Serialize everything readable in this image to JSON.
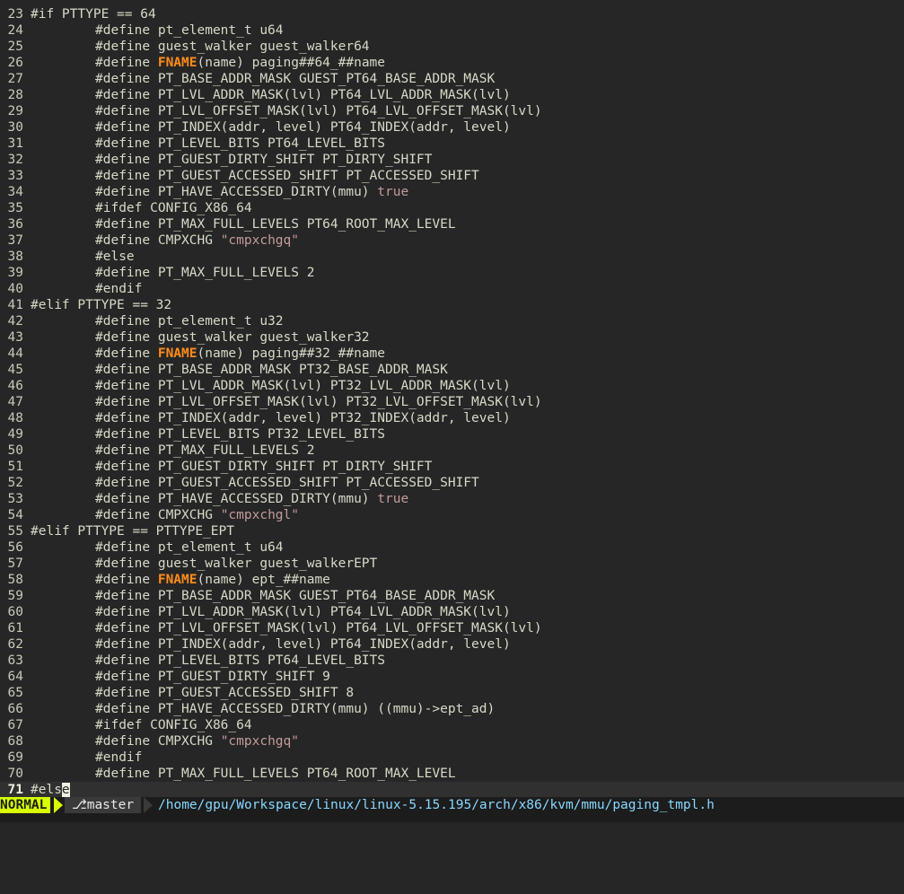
{
  "editor": {
    "current_line": "71",
    "lines": [
      {
        "num": "23",
        "indent": false,
        "tokens": [
          {
            "t": "#if PTTYPE == 64",
            "c": "normal"
          }
        ]
      },
      {
        "num": "24",
        "indent": true,
        "tokens": [
          {
            "t": "#define pt_element_t u64",
            "c": "normal"
          }
        ]
      },
      {
        "num": "25",
        "indent": true,
        "tokens": [
          {
            "t": "#define guest_walker guest_walker64",
            "c": "normal"
          }
        ]
      },
      {
        "num": "26",
        "indent": true,
        "tokens": [
          {
            "t": "#define ",
            "c": "normal"
          },
          {
            "t": "FNAME",
            "c": "fname"
          },
          {
            "t": "(name) paging##64_##name",
            "c": "normal"
          }
        ]
      },
      {
        "num": "27",
        "indent": true,
        "tokens": [
          {
            "t": "#define PT_BASE_ADDR_MASK GUEST_PT64_BASE_ADDR_MASK",
            "c": "normal"
          }
        ]
      },
      {
        "num": "28",
        "indent": true,
        "tokens": [
          {
            "t": "#define PT_LVL_ADDR_MASK(lvl) PT64_LVL_ADDR_MASK(lvl)",
            "c": "normal"
          }
        ]
      },
      {
        "num": "29",
        "indent": true,
        "tokens": [
          {
            "t": "#define PT_LVL_OFFSET_MASK(lvl) PT64_LVL_OFFSET_MASK(lvl)",
            "c": "normal"
          }
        ]
      },
      {
        "num": "30",
        "indent": true,
        "tokens": [
          {
            "t": "#define PT_INDEX(addr, level) PT64_INDEX(addr, level)",
            "c": "normal"
          }
        ]
      },
      {
        "num": "31",
        "indent": true,
        "tokens": [
          {
            "t": "#define PT_LEVEL_BITS PT64_LEVEL_BITS",
            "c": "normal"
          }
        ]
      },
      {
        "num": "32",
        "indent": true,
        "tokens": [
          {
            "t": "#define PT_GUEST_DIRTY_SHIFT PT_DIRTY_SHIFT",
            "c": "normal"
          }
        ]
      },
      {
        "num": "33",
        "indent": true,
        "tokens": [
          {
            "t": "#define PT_GUEST_ACCESSED_SHIFT PT_ACCESSED_SHIFT",
            "c": "normal"
          }
        ]
      },
      {
        "num": "34",
        "indent": true,
        "tokens": [
          {
            "t": "#define PT_HAVE_ACCESSED_DIRTY(mmu) ",
            "c": "normal"
          },
          {
            "t": "true",
            "c": "keyword"
          }
        ]
      },
      {
        "num": "35",
        "indent": true,
        "tokens": [
          {
            "t": "#ifdef CONFIG_X86_64",
            "c": "normal"
          }
        ]
      },
      {
        "num": "36",
        "indent": true,
        "tokens": [
          {
            "t": "#define PT_MAX_FULL_LEVELS PT64_ROOT_MAX_LEVEL",
            "c": "normal"
          }
        ]
      },
      {
        "num": "37",
        "indent": true,
        "tokens": [
          {
            "t": "#define CMPXCHG ",
            "c": "normal"
          },
          {
            "t": "\"cmpxchgq\"",
            "c": "string"
          }
        ]
      },
      {
        "num": "38",
        "indent": true,
        "tokens": [
          {
            "t": "#else",
            "c": "normal"
          }
        ]
      },
      {
        "num": "39",
        "indent": true,
        "tokens": [
          {
            "t": "#define PT_MAX_FULL_LEVELS 2",
            "c": "normal"
          }
        ]
      },
      {
        "num": "40",
        "indent": true,
        "tokens": [
          {
            "t": "#endif",
            "c": "normal"
          }
        ]
      },
      {
        "num": "41",
        "indent": false,
        "tokens": [
          {
            "t": "#elif PTTYPE == 32",
            "c": "normal"
          }
        ]
      },
      {
        "num": "42",
        "indent": true,
        "tokens": [
          {
            "t": "#define pt_element_t u32",
            "c": "normal"
          }
        ]
      },
      {
        "num": "43",
        "indent": true,
        "tokens": [
          {
            "t": "#define guest_walker guest_walker32",
            "c": "normal"
          }
        ]
      },
      {
        "num": "44",
        "indent": true,
        "tokens": [
          {
            "t": "#define ",
            "c": "normal"
          },
          {
            "t": "FNAME",
            "c": "fname"
          },
          {
            "t": "(name) paging##32_##name",
            "c": "normal"
          }
        ]
      },
      {
        "num": "45",
        "indent": true,
        "tokens": [
          {
            "t": "#define PT_BASE_ADDR_MASK PT32_BASE_ADDR_MASK",
            "c": "normal"
          }
        ]
      },
      {
        "num": "46",
        "indent": true,
        "tokens": [
          {
            "t": "#define PT_LVL_ADDR_MASK(lvl) PT32_LVL_ADDR_MASK(lvl)",
            "c": "normal"
          }
        ]
      },
      {
        "num": "47",
        "indent": true,
        "tokens": [
          {
            "t": "#define PT_LVL_OFFSET_MASK(lvl) PT32_LVL_OFFSET_MASK(lvl)",
            "c": "normal"
          }
        ]
      },
      {
        "num": "48",
        "indent": true,
        "tokens": [
          {
            "t": "#define PT_INDEX(addr, level) PT32_INDEX(addr, level)",
            "c": "normal"
          }
        ]
      },
      {
        "num": "49",
        "indent": true,
        "tokens": [
          {
            "t": "#define PT_LEVEL_BITS PT32_LEVEL_BITS",
            "c": "normal"
          }
        ]
      },
      {
        "num": "50",
        "indent": true,
        "tokens": [
          {
            "t": "#define PT_MAX_FULL_LEVELS 2",
            "c": "normal"
          }
        ]
      },
      {
        "num": "51",
        "indent": true,
        "tokens": [
          {
            "t": "#define PT_GUEST_DIRTY_SHIFT PT_DIRTY_SHIFT",
            "c": "normal"
          }
        ]
      },
      {
        "num": "52",
        "indent": true,
        "tokens": [
          {
            "t": "#define PT_GUEST_ACCESSED_SHIFT PT_ACCESSED_SHIFT",
            "c": "normal"
          }
        ]
      },
      {
        "num": "53",
        "indent": true,
        "tokens": [
          {
            "t": "#define PT_HAVE_ACCESSED_DIRTY(mmu) ",
            "c": "normal"
          },
          {
            "t": "true",
            "c": "keyword"
          }
        ]
      },
      {
        "num": "54",
        "indent": true,
        "tokens": [
          {
            "t": "#define CMPXCHG ",
            "c": "normal"
          },
          {
            "t": "\"cmpxchgl\"",
            "c": "string"
          }
        ]
      },
      {
        "num": "55",
        "indent": false,
        "tokens": [
          {
            "t": "#elif PTTYPE == PTTYPE_EPT",
            "c": "normal"
          }
        ]
      },
      {
        "num": "56",
        "indent": true,
        "tokens": [
          {
            "t": "#define pt_element_t u64",
            "c": "normal"
          }
        ]
      },
      {
        "num": "57",
        "indent": true,
        "tokens": [
          {
            "t": "#define guest_walker guest_walkerEPT",
            "c": "normal"
          }
        ]
      },
      {
        "num": "58",
        "indent": true,
        "tokens": [
          {
            "t": "#define ",
            "c": "normal"
          },
          {
            "t": "FNAME",
            "c": "fname"
          },
          {
            "t": "(name) ept_##name",
            "c": "normal"
          }
        ]
      },
      {
        "num": "59",
        "indent": true,
        "tokens": [
          {
            "t": "#define PT_BASE_ADDR_MASK GUEST_PT64_BASE_ADDR_MASK",
            "c": "normal"
          }
        ]
      },
      {
        "num": "60",
        "indent": true,
        "tokens": [
          {
            "t": "#define PT_LVL_ADDR_MASK(lvl) PT64_LVL_ADDR_MASK(lvl)",
            "c": "normal"
          }
        ]
      },
      {
        "num": "61",
        "indent": true,
        "tokens": [
          {
            "t": "#define PT_LVL_OFFSET_MASK(lvl) PT64_LVL_OFFSET_MASK(lvl)",
            "c": "normal"
          }
        ]
      },
      {
        "num": "62",
        "indent": true,
        "tokens": [
          {
            "t": "#define PT_INDEX(addr, level) PT64_INDEX(addr, level)",
            "c": "normal"
          }
        ]
      },
      {
        "num": "63",
        "indent": true,
        "tokens": [
          {
            "t": "#define PT_LEVEL_BITS PT64_LEVEL_BITS",
            "c": "normal"
          }
        ]
      },
      {
        "num": "64",
        "indent": true,
        "tokens": [
          {
            "t": "#define PT_GUEST_DIRTY_SHIFT 9",
            "c": "normal"
          }
        ]
      },
      {
        "num": "65",
        "indent": true,
        "tokens": [
          {
            "t": "#define PT_GUEST_ACCESSED_SHIFT 8",
            "c": "normal"
          }
        ]
      },
      {
        "num": "66",
        "indent": true,
        "tokens": [
          {
            "t": "#define PT_HAVE_ACCESSED_DIRTY(mmu) ((mmu)->ept_ad)",
            "c": "normal"
          }
        ]
      },
      {
        "num": "67",
        "indent": true,
        "tokens": [
          {
            "t": "#ifdef CONFIG_X86_64",
            "c": "normal"
          }
        ]
      },
      {
        "num": "68",
        "indent": true,
        "tokens": [
          {
            "t": "#define CMPXCHG ",
            "c": "normal"
          },
          {
            "t": "\"cmpxchgq\"",
            "c": "string"
          }
        ]
      },
      {
        "num": "69",
        "indent": true,
        "tokens": [
          {
            "t": "#endif",
            "c": "normal"
          }
        ]
      },
      {
        "num": "70",
        "indent": true,
        "tokens": [
          {
            "t": "#define PT_MAX_FULL_LEVELS PT64_ROOT_MAX_LEVEL",
            "c": "normal"
          }
        ]
      },
      {
        "num": "71",
        "indent": false,
        "current": true,
        "tokens": [
          {
            "t": "#els",
            "c": "normal"
          },
          {
            "t": "e",
            "c": "cursor"
          }
        ]
      }
    ]
  },
  "statusline": {
    "mode": "NORMAL",
    "branch": "⎇master",
    "filepath": "/home/gpu/Workspace/linux/linux-5.15.195/arch/x86/kvm/mmu/paging_tmpl.h"
  },
  "colors": {
    "background": "#262626",
    "fname": "#ff8c1a",
    "string": "#c49a9a",
    "mode_bg": "#d7ff00",
    "path": "#87d7ff"
  }
}
